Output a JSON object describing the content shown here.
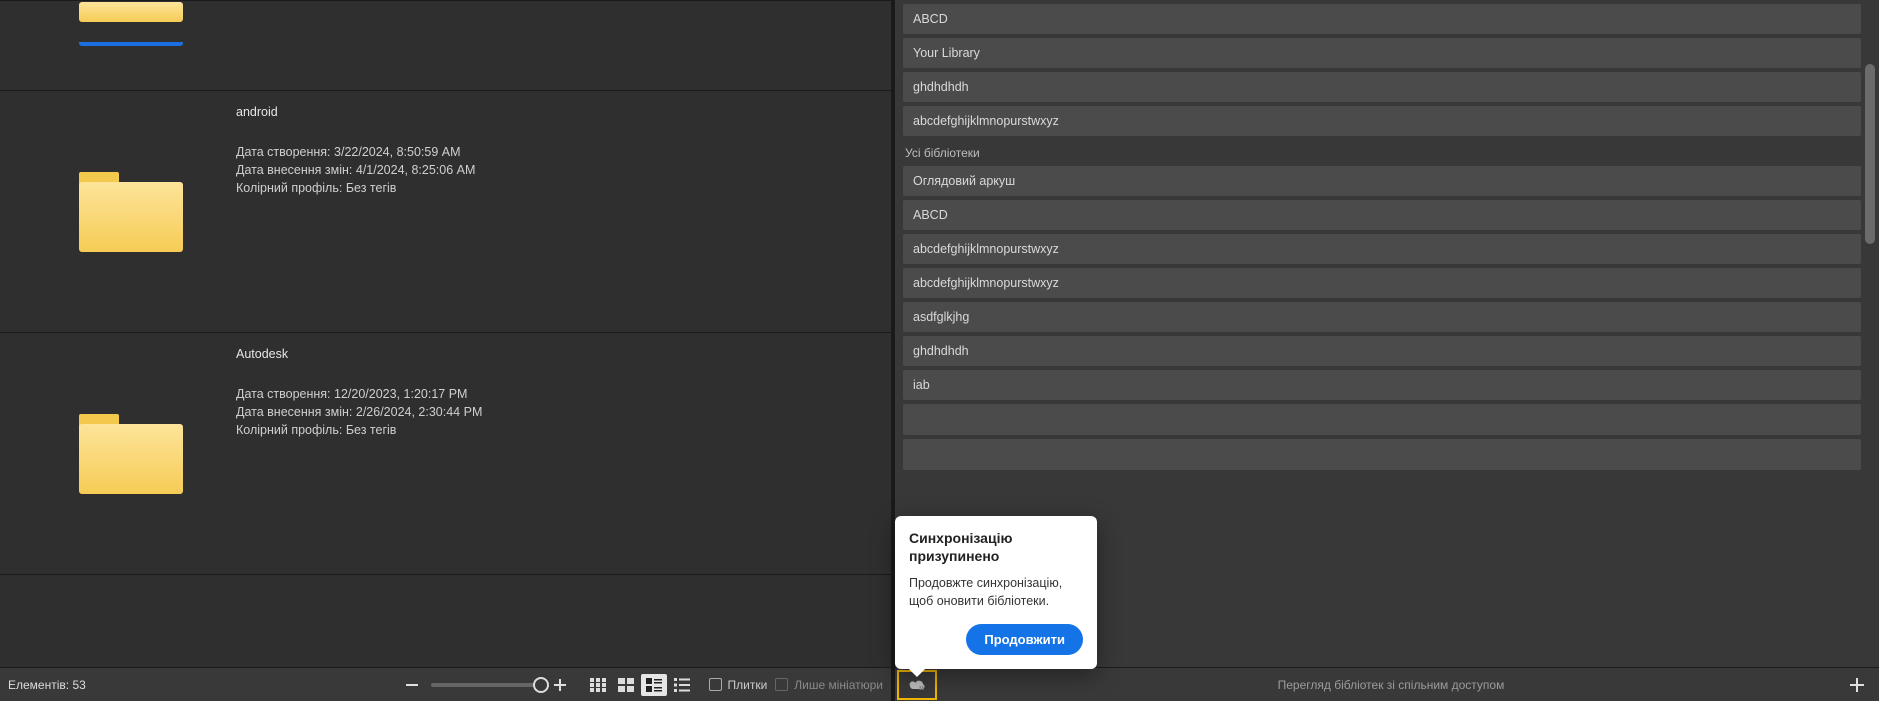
{
  "left": {
    "items": [
      {
        "name": "",
        "created_label": "",
        "created_value": "",
        "modified_label": "",
        "modified_value": "",
        "profile_label": "",
        "profile_value": "",
        "blue": true
      },
      {
        "name": "android",
        "created_label": "Дата створення:",
        "created_value": "3/22/2024, 8:50:59 AM",
        "modified_label": "Дата внесення змін:",
        "modified_value": "4/1/2024, 8:25:06 AM",
        "profile_label": "Колірний профіль:",
        "profile_value": "Без тегів",
        "blue": false
      },
      {
        "name": "Autodesk",
        "created_label": "Дата створення:",
        "created_value": "12/20/2023, 1:20:17 PM",
        "modified_label": "Дата внесення змін:",
        "modified_value": "2/26/2024, 2:30:44 PM",
        "profile_label": "Колірний профіль:",
        "profile_value": "Без тегів",
        "blue": false
      }
    ],
    "toolbar": {
      "count_label": "Елементів:",
      "count_value": "53",
      "tiles_label": "Плитки",
      "thumbs_only_label": "Лише мініатюри"
    }
  },
  "right": {
    "top_items": [
      "ABCD",
      "Your Library",
      "ghdhdhdh",
      "abcdefghijklmnopurstwxyz"
    ],
    "group_title": "Усі бібліотеки",
    "all_items": [
      "Оглядовий аркуш",
      "ABCD",
      "abcdefghijklmnopurstwxyz",
      "abcdefghijklmnopurstwxyz",
      "asdfglkjhg",
      "ghdhdhdh",
      "iab",
      "",
      ""
    ],
    "popover": {
      "title": "Синхронізацію призупинено",
      "body": "Продовжте синхронізацію, щоб оновити бібліотеки.",
      "button": "Продовжити"
    },
    "toolbar": {
      "shared_link": "Перегляд бібліотек зі спільним доступом"
    }
  }
}
